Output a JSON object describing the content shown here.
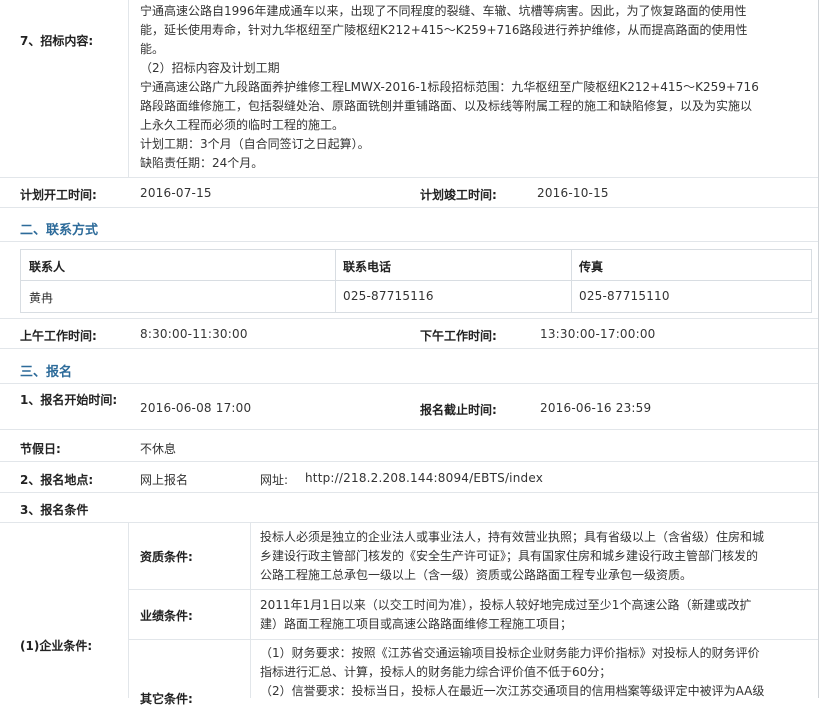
{
  "content": {
    "label": "7、招标内容:",
    "lines": [
      "宁通高速公路自1996年建成通车以来，出现了不同程度的裂缝、车辙、坑槽等病害。因此，为了恢复路面的使用性",
      "能，延长使用寿命，针对九华枢纽至广陵枢纽K212+415～K259+716路段进行养护维修，从而提高路面的使用性",
      "能。",
      "（2）招标内容及计划工期",
      "宁通高速公路广九段路面养护维修工程LMWX-2016-1标段招标范围：九华枢纽至广陵枢纽K212+415～K259+716",
      "路段路面维修施工，包括裂缝处治、原路面铣刨并重铺路面、以及标线等附属工程的施工和缺陷修复，以及为实施以",
      "上永久工程而必须的临时工程的施工。",
      "计划工期：3个月（自合同签订之日起算）。",
      "缺陷责任期：24个月。"
    ]
  },
  "schedule": {
    "start_label": "计划开工时间:",
    "start_value": "2016-07-15",
    "end_label": "计划竣工时间:",
    "end_value": "2016-10-15"
  },
  "section_contact": "二、联系方式",
  "contact_table": {
    "headers": [
      "联系人",
      "联系电话",
      "传真"
    ],
    "row": [
      "黄冉",
      "025-87715116",
      "025-87715110"
    ]
  },
  "work_hours": {
    "am_label": "上午工作时间:",
    "am_value": "8:30:00-11:30:00",
    "pm_label": "下午工作时间:",
    "pm_value": "13:30:00-17:00:00"
  },
  "section_signup": "三、报名",
  "signup": {
    "start_label": "1、报名开始时间:",
    "start_value": "2016-06-08 17:00",
    "end_label": "报名截止时间:",
    "end_value": "2016-06-16 23:59",
    "holiday_label": "节假日:",
    "holiday_value": "不休息",
    "place_label": "2、报名地点:",
    "place_value": "网上报名",
    "url_label": "网址:",
    "url_value": "http://218.2.208.144:8094/EBTS/index",
    "conditions_label": "3、报名条件"
  },
  "enterprise": {
    "label": "(1)企业条件:",
    "qual_label": "资质条件:",
    "qual_lines": [
      "投标人必须是独立的企业法人或事业法人，持有效营业执照；具有省级以上（含省级）住房和城",
      "乡建设行政主管部门核发的《安全生产许可证》；具有国家住房和城乡建设行政主管部门核发的",
      "公路工程施工总承包一级以上（含一级）资质或公路路面工程专业承包一级资质。"
    ],
    "perf_label": "业绩条件:",
    "perf_lines": [
      "2011年1月1日以来（以交工时间为准），投标人较好地完成过至少1个高速公路（新建或改扩",
      "建）路面工程施工项目或高速公路路面维修工程施工项目；"
    ],
    "fin_label": "其它条件:",
    "fin_lines": [
      "（1）财务要求：按照《江苏省交通运输项目投标企业财务能力评价指标》对投标人的财务评价",
      "指标进行汇总、计算，投标人的财务能力综合评价值不低于60分；",
      "（2）信誉要求：投标当日，投标人在最近一次江苏交通项目的信用档案等级评定中被评为AA级"
    ]
  }
}
